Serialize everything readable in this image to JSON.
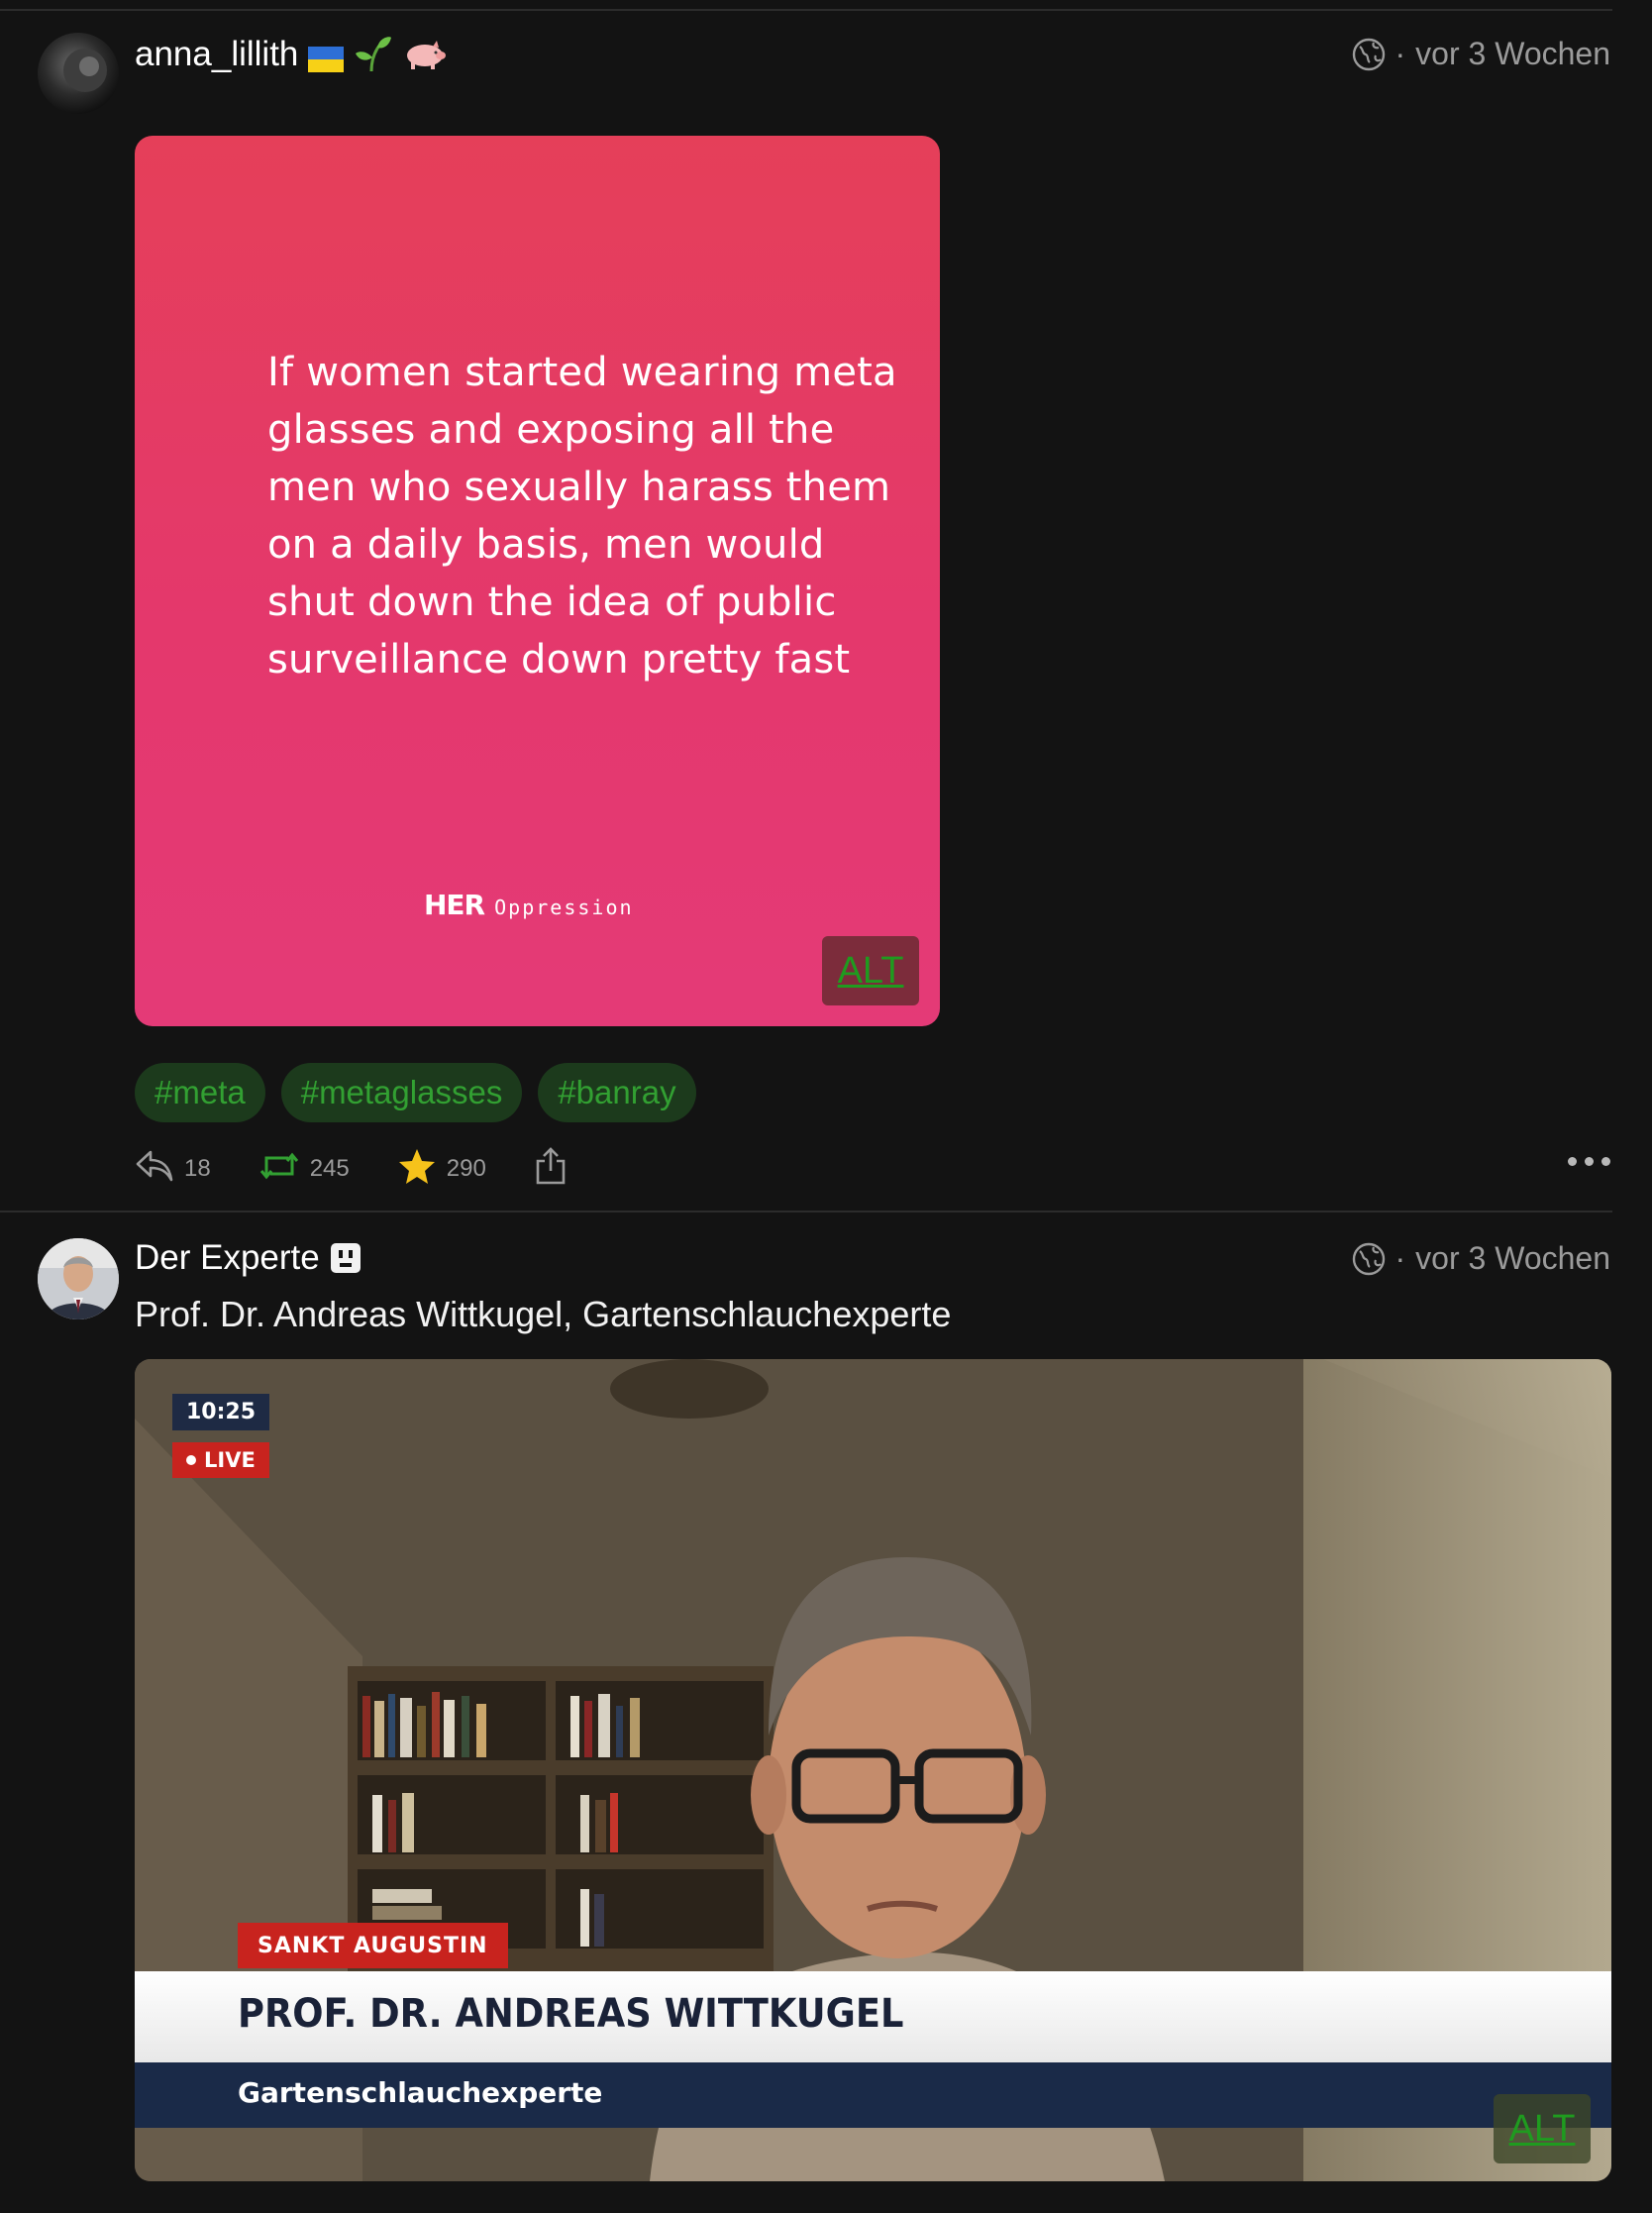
{
  "post1": {
    "username": "anna_lillith",
    "username_emojis": [
      "ukraine-flag",
      "seedling",
      "pig"
    ],
    "timestamp": "vor 3 Wochen",
    "timestamp_prefix": "·",
    "image": {
      "quote": "If women started wearing meta glasses and exposing all the men who sexually harass them on a daily basis, men would shut down the idea of public surveillance down pretty fast",
      "brand_name": "HER",
      "brand_sub": "Oppression",
      "alt_label": "ALT",
      "bg_colors": [
        "#e53f59",
        "#e43a77"
      ]
    },
    "tags": [
      "#meta",
      "#metaglasses",
      "#banray"
    ],
    "actions": {
      "replies": "18",
      "boosts": "245",
      "favourites": "290"
    }
  },
  "post2": {
    "display_name": "Der Experte",
    "timestamp": "vor 3 Wochen",
    "timestamp_prefix": "·",
    "bio": "Prof. Dr. Andreas Wittkugel, Gartenschlauchexperte",
    "video": {
      "clock": "10:25",
      "live": "LIVE",
      "location": "SANKT AUGUSTIN",
      "name": "PROF. DR. ANDREAS WITTKUGEL",
      "subtitle": "Gartenschlauchexperte",
      "alt_label": "ALT"
    }
  },
  "colors": {
    "accent_green": "#32a032",
    "background": "#131313",
    "muted": "#9b9b9b",
    "star": "#f6c21b"
  }
}
